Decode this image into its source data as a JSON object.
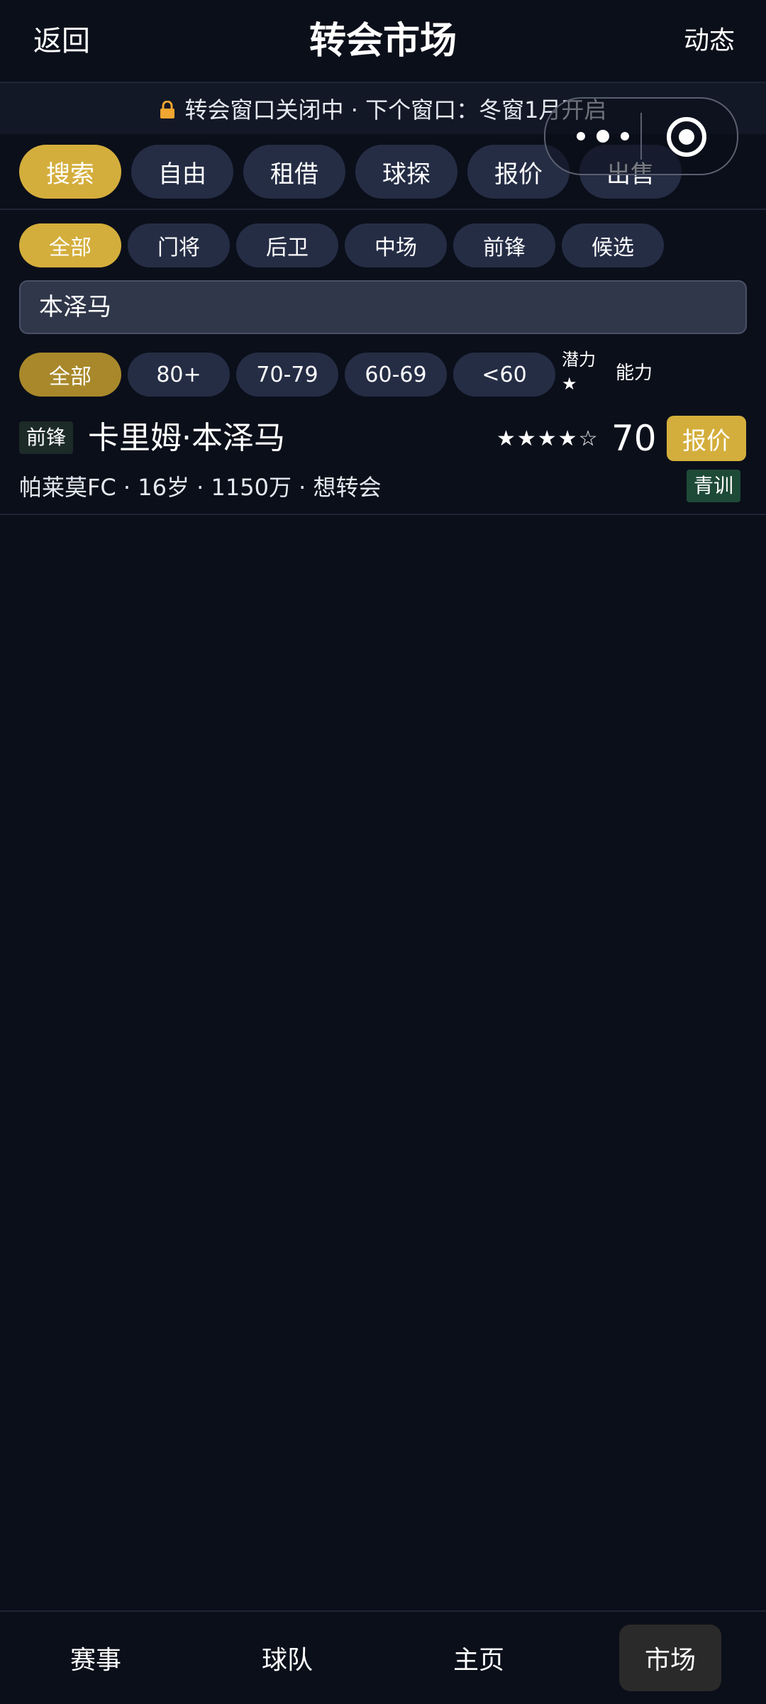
{
  "header": {
    "back_label": "返回",
    "title": "转会市场",
    "activity_label": "动态"
  },
  "notice": {
    "icon": "lock-icon",
    "text": "转会窗口关闭中 · 下个窗口：冬窗1月开启"
  },
  "capsule": {
    "more_icon": "more-icon",
    "close_icon": "close-target-icon"
  },
  "tabs": [
    {
      "label": "搜索",
      "active": true
    },
    {
      "label": "自由",
      "active": false
    },
    {
      "label": "租借",
      "active": false
    },
    {
      "label": "球探",
      "active": false
    },
    {
      "label": "报价",
      "active": false
    },
    {
      "label": "出售",
      "active": false
    }
  ],
  "position_filters": [
    {
      "label": "全部",
      "active": true
    },
    {
      "label": "门将",
      "active": false
    },
    {
      "label": "后卫",
      "active": false
    },
    {
      "label": "中场",
      "active": false
    },
    {
      "label": "前锋",
      "active": false
    },
    {
      "label": "候选",
      "active": false
    }
  ],
  "search": {
    "value": "本泽马"
  },
  "rating_filters": [
    {
      "label": "全部",
      "active": true
    },
    {
      "label": "80+",
      "active": false
    },
    {
      "label": "70-79",
      "active": false
    },
    {
      "label": "60-69",
      "active": false
    },
    {
      "label": "<60",
      "active": false
    }
  ],
  "sort": {
    "potential_label": "潜力★",
    "ability_label": "能力"
  },
  "players": [
    {
      "position": "前锋",
      "name": "卡里姆·本泽马",
      "stars": "★★★★☆",
      "rating": "70",
      "offer_label": "报价",
      "meta": "帕莱莫FC · 16岁 · 1150万 · 想转会",
      "tag": "青训"
    }
  ],
  "bottom_nav": [
    {
      "label": "赛事",
      "active": false
    },
    {
      "label": "球队",
      "active": false
    },
    {
      "label": "主页",
      "active": false
    },
    {
      "label": "市场",
      "active": true
    }
  ],
  "colors": {
    "background": "#0b0f1a",
    "accent": "#d4ae3c",
    "chip": "#252d45",
    "youth_badge": "#1e4a38"
  }
}
